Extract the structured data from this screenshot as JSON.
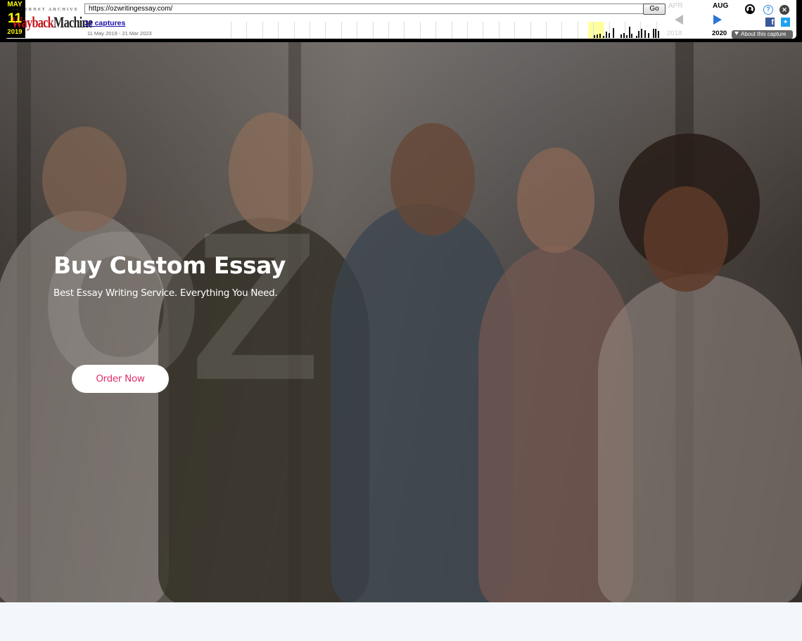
{
  "wayback": {
    "logo_top": "INTERNET ARCHIVE",
    "logo_word1": "Wayback",
    "logo_word2": "Machine",
    "url": "https://ozwritingessay.com/",
    "go_label": "Go",
    "captures_link": "31 captures",
    "date_range": "11 May 2019 - 21 Mar 2023",
    "prev_month": "APR",
    "current_month": "MAY",
    "next_month": "AUG",
    "current_day": "11",
    "prev_year": "2018",
    "current_year": "2019",
    "next_year": "2020",
    "about_label": "About this capture",
    "icons": [
      "user-icon",
      "help-icon",
      "close-icon",
      "facebook-icon",
      "twitter-icon"
    ]
  },
  "hero": {
    "watermark": "OZ",
    "title": "Buy Custom Essay",
    "subtitle": "Best Essay Writing Service. Everything You Need.",
    "cta_label": "Order Now",
    "cta_color": "#e0306e"
  }
}
